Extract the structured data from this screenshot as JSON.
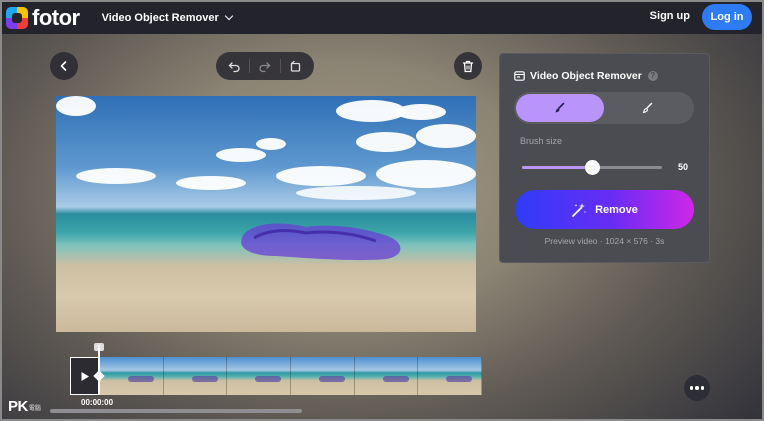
{
  "app": {
    "logo_text": "fotor",
    "product_menu_label": "Video Object Remover",
    "signup_label": "Sign up",
    "login_label": "Log in"
  },
  "panel": {
    "title": "Video Object Remover",
    "brush_size_label": "Brush size",
    "brush_size_value": "50",
    "brush_size_fraction": 0.5,
    "remove_label": "Remove",
    "preview_info": "Preview video · 1024 × 576 · 3s",
    "active_mode": "brush",
    "modes": [
      "brush",
      "eraser"
    ]
  },
  "timeline": {
    "time": "00:00:00",
    "frame_count": 6
  },
  "watermark": {
    "main": "PK",
    "sub": "電腦"
  },
  "icons": {
    "back": "chevron-left-icon",
    "undo": "undo-icon",
    "redo": "redo-icon",
    "reset": "reset-icon",
    "delete": "trash-icon",
    "play": "play-icon",
    "more": "more-icon"
  },
  "colors": {
    "accent_blue": "#2d7cf6",
    "brush_purple": "#b995fb",
    "remove_gradient_start": "#2f3cf7",
    "remove_gradient_end": "#d126e8",
    "mask_purple": "#6a3fd6"
  }
}
